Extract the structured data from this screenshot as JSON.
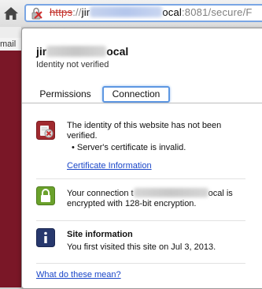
{
  "toolbar": {
    "url_scheme": "https",
    "url_sep": "://",
    "url_host_start": "jir",
    "url_host_end": "ocal",
    "url_port_path": ":8081/secure/F"
  },
  "page": {
    "visible_text": "mail"
  },
  "popup": {
    "site_name_start": "jir",
    "site_name_end": "ocal",
    "identity_status": "Identity not verified",
    "tabs": [
      {
        "label": "Permissions"
      },
      {
        "label": "Connection"
      }
    ],
    "identity_section": {
      "icon": "identity-error-icon",
      "message": "The identity of this website has not been verified.",
      "bullet": "• Server's certificate is invalid.",
      "link": "Certificate Information"
    },
    "connection_section": {
      "icon": "connection-lock-icon",
      "message_start": "Your connection t",
      "message_end": "ocal is",
      "message_line2": "encrypted with 128-bit encryption."
    },
    "site_info_section": {
      "icon": "info-icon",
      "title": "Site information",
      "message": "You first visited this site on Jul 3, 2013."
    },
    "help_link": "What do these mean?"
  },
  "colors": {
    "error": "#a02a2f",
    "secure": "#6aa12b",
    "info": "#27386d",
    "link": "#1a46c8",
    "focus": "#5d97e2"
  }
}
